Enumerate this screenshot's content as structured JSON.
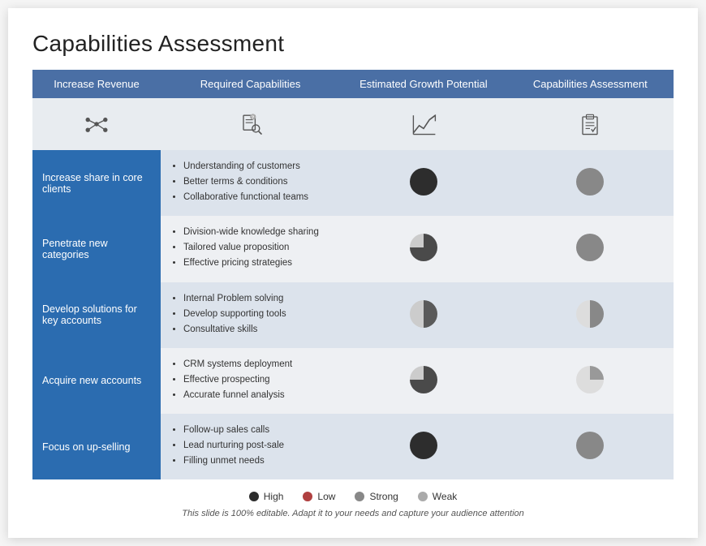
{
  "title": "Capabilities Assessment",
  "header": {
    "col1": "Increase Revenue",
    "col2": "Required Capabilities",
    "col3": "Estimated Growth Potential",
    "col4": "Capabilities Assessment"
  },
  "rows": [
    {
      "label": "Increase share in core clients",
      "capabilities": [
        "Understanding of customers",
        "Better terms & conditions",
        "Collaborative functional teams"
      ],
      "growth": "full-dark",
      "assessment": "full-gray"
    },
    {
      "label": "Penetrate new categories",
      "capabilities": [
        "Division-wide knowledge sharing",
        "Tailored value proposition",
        "Effective pricing strategies"
      ],
      "growth": "75-dark",
      "assessment": "full-gray"
    },
    {
      "label": "Develop solutions for key accounts",
      "capabilities": [
        "Internal Problem solving",
        "Develop supporting tools",
        "Consultative skills"
      ],
      "growth": "50-dark",
      "assessment": "50-gray"
    },
    {
      "label": "Acquire new accounts",
      "capabilities": [
        "CRM systems deployment",
        "Effective prospecting",
        "Accurate funnel analysis"
      ],
      "growth": "75-dark",
      "assessment": "25-gray"
    },
    {
      "label": "Focus on up-selling",
      "capabilities": [
        "Follow-up sales calls",
        "Lead nurturing post-sale",
        "Filling unmet needs"
      ],
      "growth": "full-dark",
      "assessment": "full-gray"
    }
  ],
  "legend": [
    {
      "label": "High",
      "color": "#2d2d2d"
    },
    {
      "label": "Low",
      "color": "#c0392b"
    },
    {
      "label": "Strong",
      "color": "#888888"
    },
    {
      "label": "Weak",
      "color": "#aaaaaa"
    }
  ],
  "footer": "This slide is 100% editable. Adapt it to your needs and capture your audience attention"
}
